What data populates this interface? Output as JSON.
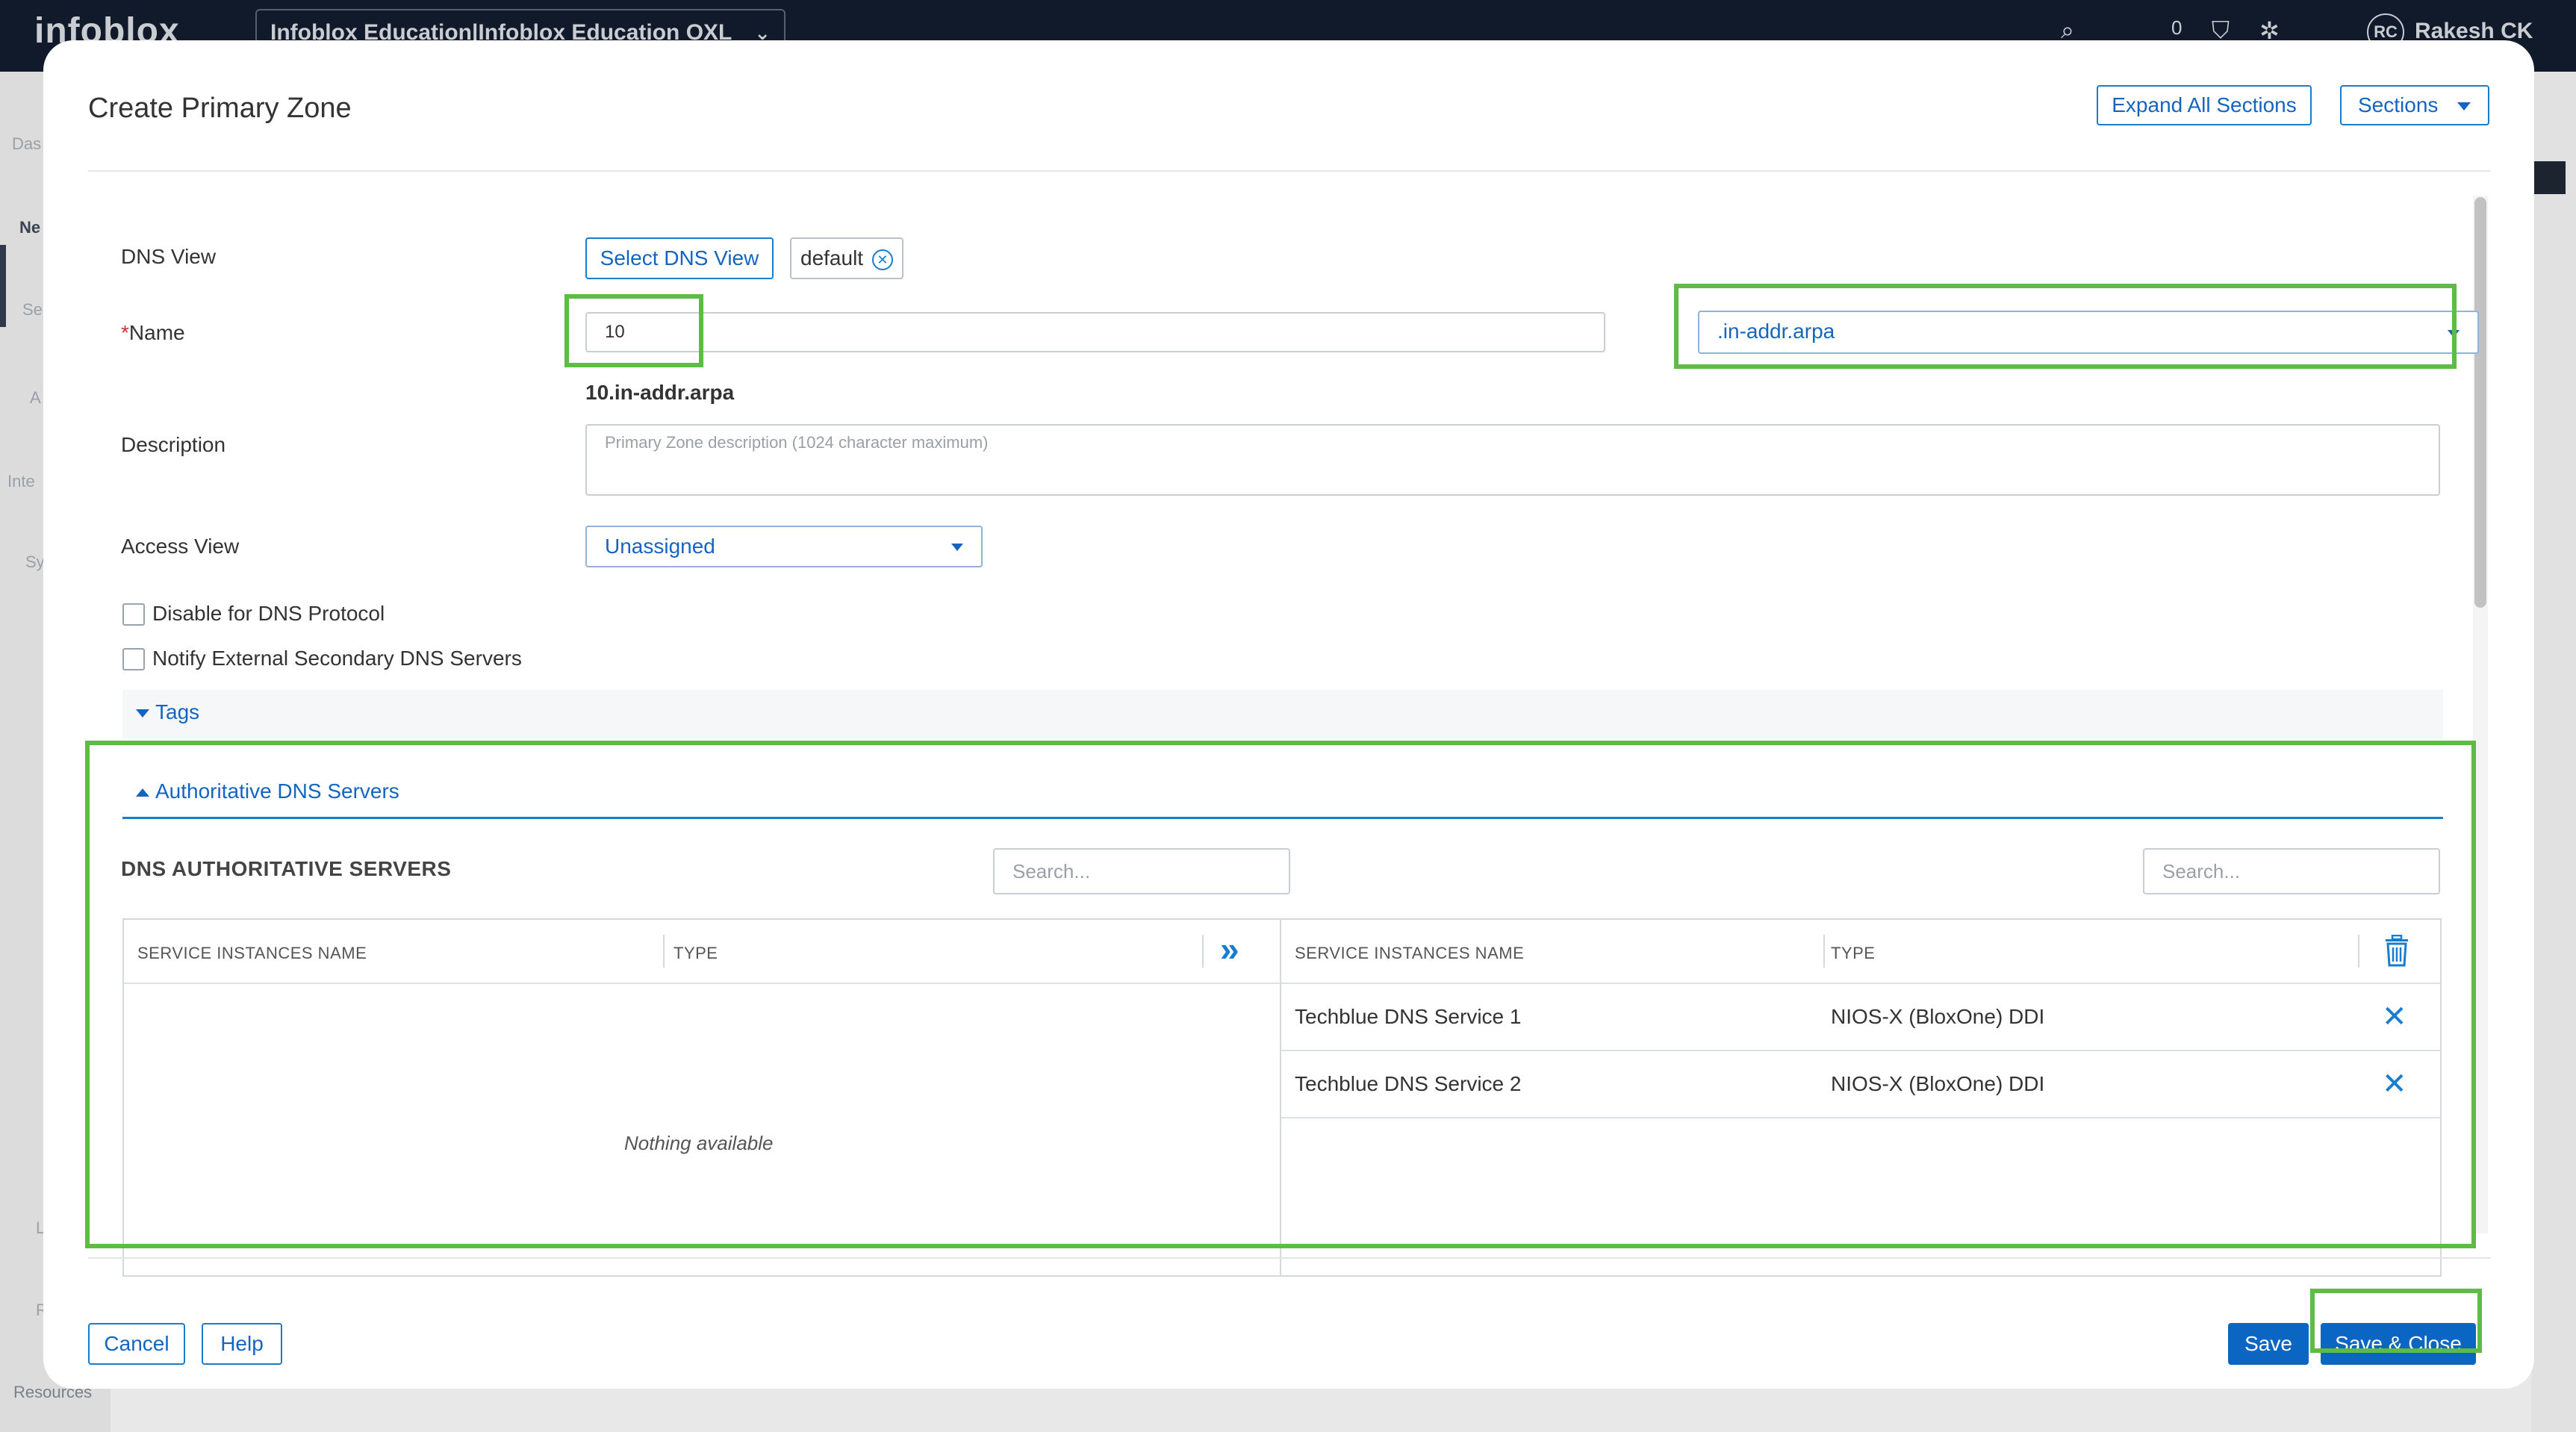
{
  "app": {
    "logo_text": "infoblox",
    "tenant": "Infoblox Education|Infoblox Education OXL",
    "user_initials": "RC",
    "user_name": "Rakesh CK",
    "notifications_count": "0",
    "left_nav_hints": [
      "Das",
      "Ne",
      "Se",
      "A",
      "Inte",
      "Sy",
      "L",
      "R"
    ],
    "resources_label": "Resources"
  },
  "modal": {
    "title": "Create Primary Zone",
    "expand_all_label": "Expand All Sections",
    "sections_label": "Sections",
    "dns_view_label": "DNS View",
    "select_dns_view_label": "Select DNS View",
    "dns_view_tag": "default",
    "name_required_mark": "*",
    "name_label": "Name",
    "name_value": "10",
    "zone_suffix": ".in-addr.arpa",
    "fqdn_preview": "10.in-addr.arpa",
    "description_label": "Description",
    "description_placeholder": "Primary Zone description (1024 character maximum)",
    "access_view_label": "Access View",
    "access_view_value": "Unassigned",
    "disable_dns_label": "Disable for DNS Protocol",
    "notify_secondary_label": "Notify External Secondary DNS Servers",
    "tags_section": "Tags",
    "auth_section": "Authoritative DNS Servers",
    "auth_servers_heading": "DNS AUTHORITATIVE SERVERS",
    "search_placeholder_left": "Search...",
    "search_placeholder_right": "Search...",
    "available": {
      "columns": [
        "SERVICE INSTANCES NAME",
        "TYPE"
      ],
      "empty_text": "Nothing available"
    },
    "selected": {
      "columns": [
        "SERVICE INSTANCES NAME",
        "TYPE"
      ],
      "rows": [
        {
          "name": "Techblue DNS Service 1",
          "type": "NIOS-X (BloxOne) DDI"
        },
        {
          "name": "Techblue DNS Service 2",
          "type": "NIOS-X (BloxOne) DDI"
        }
      ]
    },
    "cancel_label": "Cancel",
    "help_label": "Help",
    "save_label": "Save",
    "save_close_label": "Save & Close"
  },
  "colors": {
    "accent": "#0a66c2",
    "highlight": "#5dbb46",
    "topbar": "#101a2a"
  }
}
